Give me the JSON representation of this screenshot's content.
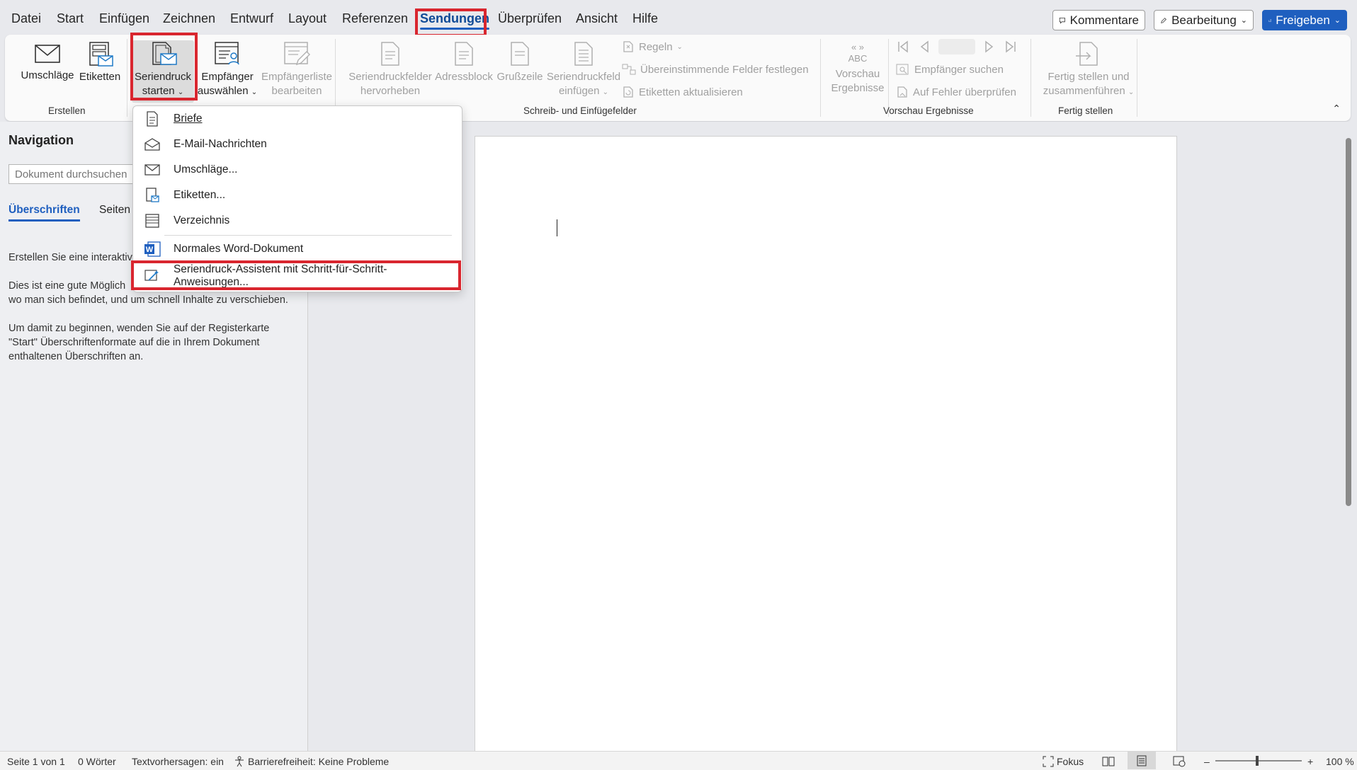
{
  "menu": {
    "tabs": [
      "Datei",
      "Start",
      "Einfügen",
      "Zeichnen",
      "Entwurf",
      "Layout",
      "Referenzen",
      "Sendungen",
      "Überprüfen",
      "Ansicht",
      "Hilfe"
    ],
    "comments": "Kommentare",
    "editing": "Bearbeitung",
    "share": "Freigeben"
  },
  "ribbon": {
    "envelopes": "Umschläge",
    "labels": "Etiketten",
    "start_merge": [
      "Seriendruck",
      "starten"
    ],
    "select_recipients": [
      "Empfänger",
      "auswählen"
    ],
    "edit_list": [
      "Empfängerliste",
      "bearbeiten"
    ],
    "highlight_fields": [
      "Seriendruckfelder",
      "hervorheben"
    ],
    "address_block": "Adressblock",
    "greeting": "Grußzeile",
    "insert_field": [
      "Seriendruckfeld",
      "einfügen"
    ],
    "rules": "Regeln",
    "match_fields": "Übereinstimmende Felder festlegen",
    "update_labels": "Etiketten aktualisieren",
    "preview": [
      "Vorschau",
      "Ergebnisse"
    ],
    "abc": "ABC",
    "find_recipient": "Empfänger suchen",
    "check_errors": "Auf Fehler überprüfen",
    "finish": [
      "Fertig stellen und",
      "zusammenführen"
    ],
    "groups": {
      "create": "Erstellen",
      "write_insert": "Schreib- und Einfügefelder",
      "preview": "Vorschau Ergebnisse",
      "finish": "Fertig stellen"
    }
  },
  "dropdown": {
    "items": [
      "Briefe",
      "E-Mail-Nachrichten",
      "Umschläge...",
      "Etiketten...",
      "Verzeichnis",
      "Normales Word-Dokument",
      "Seriendruck-Assistent mit Schritt-für-Schritt-Anweisungen..."
    ]
  },
  "nav": {
    "title": "Navigation",
    "search_placeholder": "Dokument durchsuchen",
    "tab_headings": "Überschriften",
    "tab_pages": "Seiten",
    "p1": "Erstellen Sie eine interaktiv",
    "p2a": "Dies ist eine gute Möglich",
    "p2b": "wo man sich befindet, und um schnell Inhalte zu verschieben.",
    "p3": "Um damit zu beginnen, wenden Sie auf der Registerkarte \"Start\" Überschriftenformate auf die in Ihrem Dokument enthaltenen Überschriften an."
  },
  "status": {
    "page": "Seite 1 von 1",
    "words": "0 Wörter",
    "predictions": "Textvorhersagen: ein",
    "accessibility": "Barrierefreiheit: Keine Probleme",
    "focus": "Fokus",
    "zoom": "100 %"
  },
  "colors": {
    "accent": "#1f5fbf",
    "highlight": "#d9262f"
  }
}
